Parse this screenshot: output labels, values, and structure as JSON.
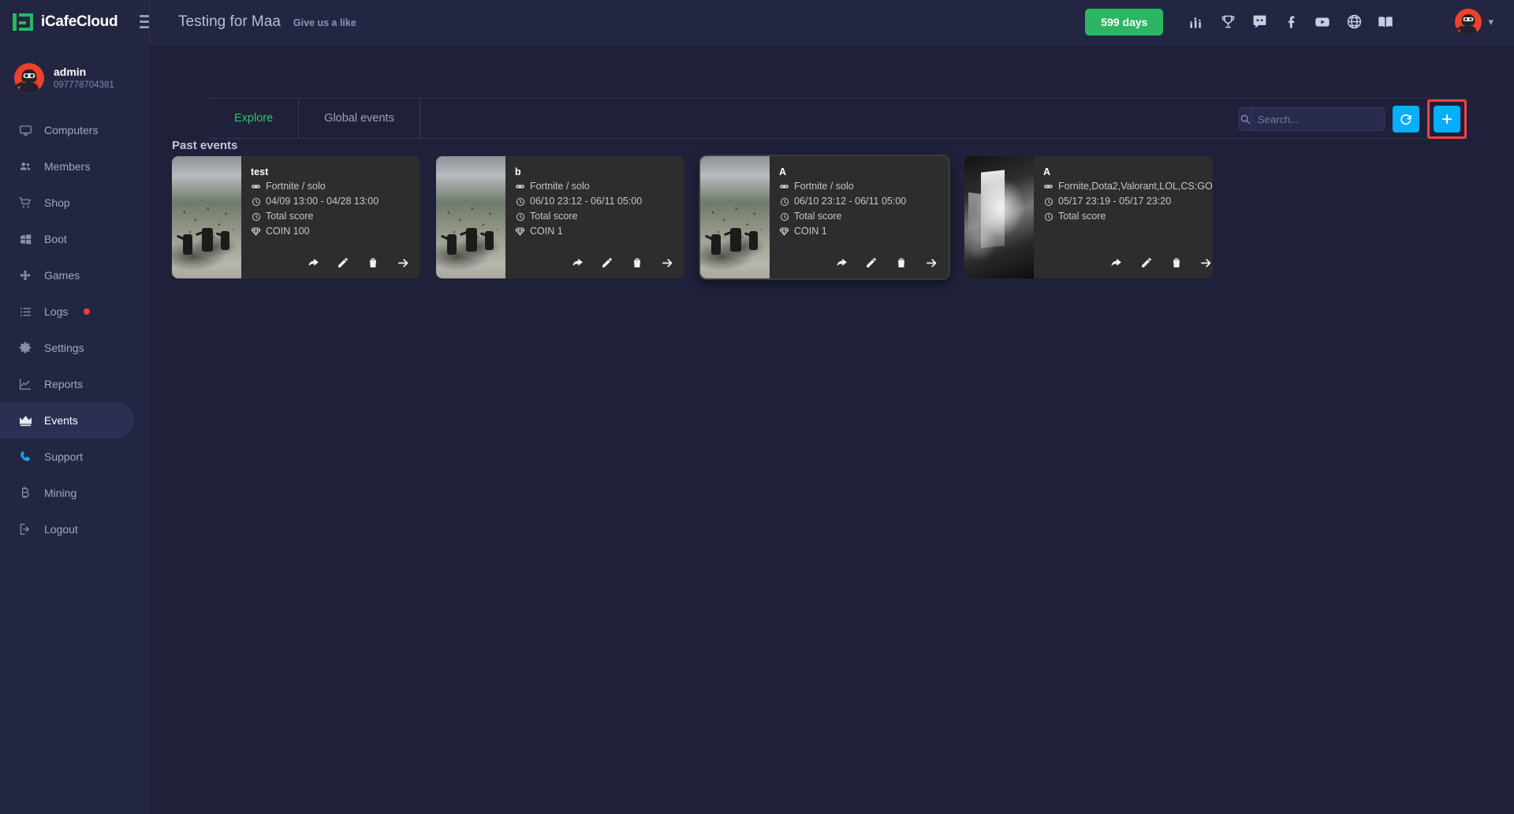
{
  "brand": {
    "name": "iCafeCloud",
    "logo_icon": "icafecloud-logo-icon",
    "menu_icon": "hamburger-icon"
  },
  "header": {
    "title": "Testing for Maa",
    "like_text": "Give us a like",
    "days_badge": "599 days",
    "icons": [
      {
        "name": "ranking-icon",
        "label": "Ranking"
      },
      {
        "name": "trophy-icon",
        "label": "Trophy"
      },
      {
        "name": "discord-icon",
        "label": "Discord"
      },
      {
        "name": "facebook-icon",
        "label": "Facebook"
      },
      {
        "name": "youtube-icon",
        "label": "YouTube"
      },
      {
        "name": "globe-icon",
        "label": "Language"
      },
      {
        "name": "book-icon",
        "label": "Docs"
      }
    ],
    "caret_icon": "chevron-down-icon",
    "accent_green": "#2cb563",
    "accent_blue": "#06aefb",
    "accent_red": "#f1402a"
  },
  "sidebar": {
    "user": {
      "name": "admin",
      "id": "097778704381"
    },
    "items": [
      {
        "label": "Computers",
        "icon": "monitor-icon",
        "active": false
      },
      {
        "label": "Members",
        "icon": "users-icon",
        "active": false
      },
      {
        "label": "Shop",
        "icon": "cart-icon",
        "active": false
      },
      {
        "label": "Boot",
        "icon": "windows-icon",
        "active": false
      },
      {
        "label": "Games",
        "icon": "gamepad-icon",
        "active": false
      },
      {
        "label": "Logs",
        "icon": "list-icon",
        "active": false,
        "badge": true
      },
      {
        "label": "Settings",
        "icon": "gear-icon",
        "active": false
      },
      {
        "label": "Reports",
        "icon": "chart-line-icon",
        "active": false
      },
      {
        "label": "Events",
        "icon": "crown-icon",
        "active": true
      },
      {
        "label": "Support",
        "icon": "phone-icon",
        "active": false,
        "blue": true
      },
      {
        "label": "Mining",
        "icon": "bitcoin-icon",
        "active": false
      },
      {
        "label": "Logout",
        "icon": "logout-icon",
        "active": false
      }
    ]
  },
  "main": {
    "tabs": [
      {
        "label": "Explore",
        "active": true
      },
      {
        "label": "Global events",
        "active": false
      }
    ],
    "search": {
      "value": "",
      "placeholder": "Search...",
      "icon": "search-icon"
    },
    "refresh_button": {
      "icon": "refresh-icon",
      "label": ""
    },
    "add_button": {
      "icon": "plus-icon",
      "label": "",
      "highlighted": true,
      "highlight_color": "#fb4141"
    },
    "section_title": "Past events",
    "cards": [
      {
        "title": "test",
        "game": "Fortnite / solo",
        "dates": "04/09 13:00 - 04/28 13:00",
        "score": "Total score",
        "prize": "COIN 100",
        "thumb": "fortnite",
        "selected": false,
        "actions": [
          "share-icon",
          "edit-icon",
          "delete-icon",
          "open-icon"
        ]
      },
      {
        "title": "b",
        "game": "Fortnite / solo",
        "dates": "06/10 23:12 - 06/11 05:00",
        "score": "Total score",
        "prize": "COIN 1",
        "thumb": "fortnite",
        "selected": false,
        "actions": [
          "share-icon",
          "edit-icon",
          "delete-icon",
          "open-icon"
        ]
      },
      {
        "title": "A",
        "game": "Fortnite / solo",
        "dates": "06/10 23:12 - 06/11 05:00",
        "score": "Total score",
        "prize": "COIN 1",
        "thumb": "fortnite",
        "selected": true,
        "actions": [
          "share-icon",
          "edit-icon",
          "delete-icon",
          "open-icon"
        ]
      },
      {
        "title": "A",
        "game": "Fornite,Dota2,Valorant,LOL,CS:GO",
        "dates": "05/17 23:19 - 05/17 23:20",
        "score": "Total score",
        "prize": "",
        "thumb": "valorant",
        "selected": false,
        "actions": [
          "share-icon",
          "edit-icon",
          "delete-icon",
          "open-icon"
        ]
      }
    ]
  }
}
